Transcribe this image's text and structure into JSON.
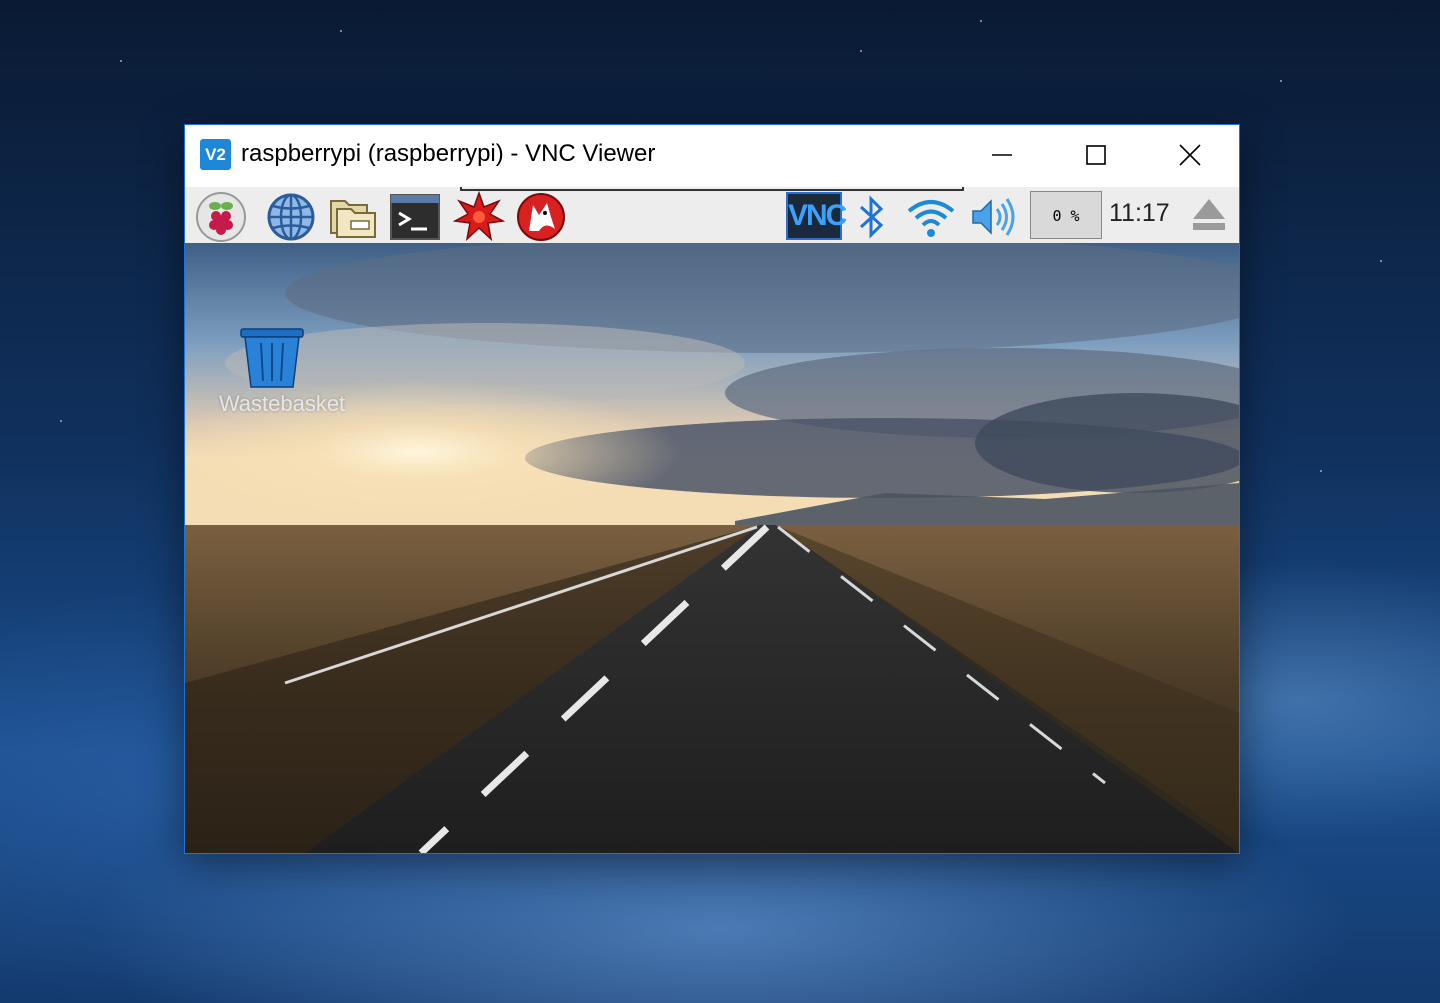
{
  "window": {
    "app_icon_text": "V2",
    "title": "raspberrypi (raspberrypi) - VNC Viewer",
    "controls": [
      "minimize",
      "maximize",
      "close"
    ]
  },
  "taskbar": {
    "launchers": [
      "raspberry-menu-icon",
      "web-browser-icon",
      "file-manager-icon",
      "terminal-icon",
      "mathematica-icon",
      "wolfram-icon"
    ],
    "tray": {
      "vnc_text": "VNC",
      "cpu_usage": "0 %",
      "clock": "11:17"
    }
  },
  "desktop": {
    "wastebasket_label": "Wastebasket"
  },
  "colors": {
    "accent": "#1e73d6",
    "taskbar_bg": "#ededed"
  }
}
